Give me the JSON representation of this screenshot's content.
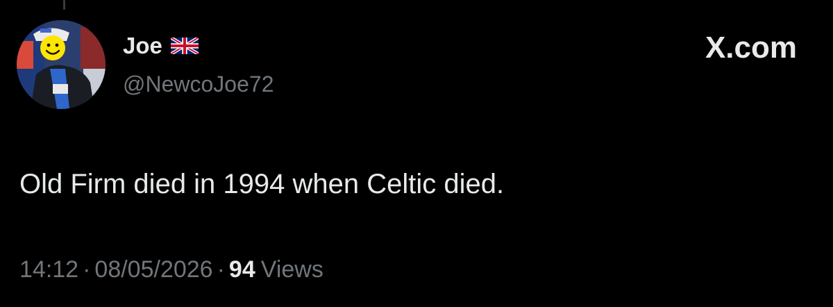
{
  "tweet": {
    "author": {
      "display_name": "Joe",
      "flag_icon": "uk-flag-icon",
      "handle": "@NewcoJoe72",
      "avatar_icon": "avatar-image"
    },
    "brand": "X.com",
    "text": "Old Firm died in 1994 when Celtic died.",
    "meta": {
      "time": "14:12",
      "separator": "·",
      "date": "08/05/2026",
      "views_count": "94",
      "views_label": "Views"
    }
  },
  "colors": {
    "background": "#000000",
    "primary_text": "#e7e9ea",
    "secondary_text": "#71767b"
  }
}
